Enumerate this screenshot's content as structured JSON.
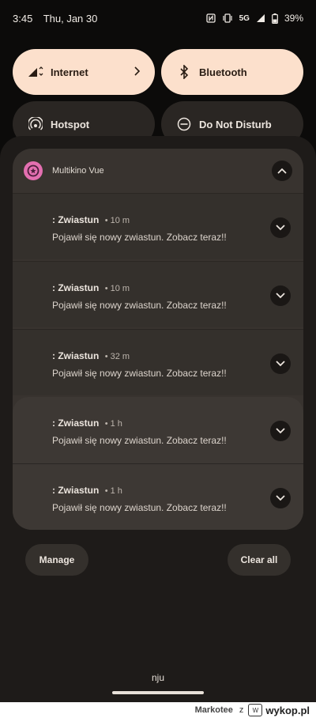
{
  "status_bar": {
    "time": "3:45",
    "date": "Thu, Jan 30",
    "network": "5G",
    "battery": "39%"
  },
  "quick_tiles": [
    {
      "label": "Internet",
      "icon": "signal-icon",
      "active": true
    },
    {
      "label": "Bluetooth",
      "icon": "bluetooth-icon",
      "active": true
    },
    {
      "label": "Hotspot",
      "icon": "hotspot-icon",
      "active": false
    },
    {
      "label": "Do Not Disturb",
      "icon": "dnd-icon",
      "active": false
    }
  ],
  "group": {
    "app_name": "Multikino Vue",
    "notifications": [
      {
        "title": ": Zwiastun",
        "time": "10 m",
        "body": "Pojawił się nowy zwiastun. Zobacz teraz!!"
      },
      {
        "title": ": Zwiastun",
        "time": "10 m",
        "body": "Pojawił się nowy zwiastun. Zobacz teraz!!"
      },
      {
        "title": ": Zwiastun",
        "time": "32 m",
        "body": "Pojawił się nowy zwiastun. Zobacz teraz!!"
      },
      {
        "title": ": Zwiastun",
        "time": "1 h",
        "body": "Pojawił się nowy zwiastun. Zobacz teraz!!"
      },
      {
        "title": ": Zwiastun",
        "time": "1 h",
        "body": "Pojawił się nowy zwiastun. Zobacz teraz!!"
      }
    ]
  },
  "actions": {
    "manage": "Manage",
    "clear_all": "Clear all"
  },
  "carrier": "nju",
  "footer": {
    "user": "Markotee",
    "z": "z",
    "site": "wykop.pl"
  },
  "colors": {
    "accent_tile": "#fce0cc",
    "app_icon": "#e36fb0",
    "shade": "#1e1b19"
  }
}
